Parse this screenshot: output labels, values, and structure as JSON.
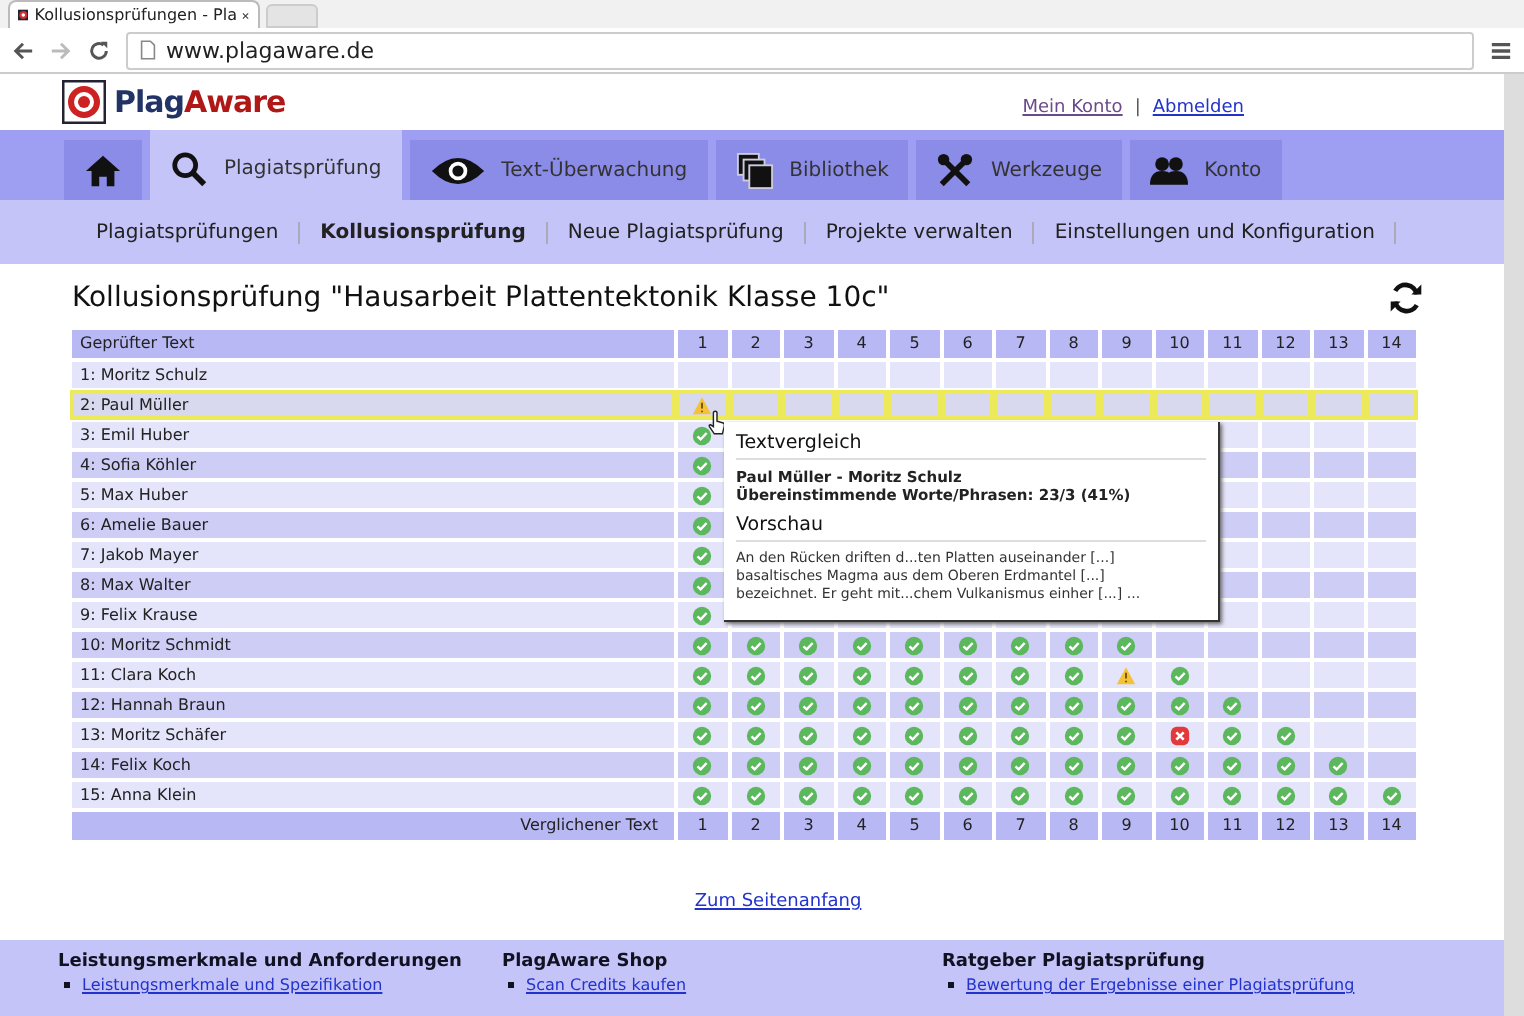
{
  "browser": {
    "tab_title": "Kollusionsprüfungen - Pla",
    "address": "www.plagaware.de"
  },
  "header": {
    "logo_first": "Plag",
    "logo_second": "Aware",
    "links": [
      "Mein Konto",
      "Abmelden"
    ],
    "separator": "|"
  },
  "nav": [
    {
      "kind": "home",
      "selected": false
    },
    {
      "label": "Plagiatsprüfung",
      "kind": "search",
      "selected": true
    },
    {
      "label": "Text-Überwachung",
      "kind": "eye",
      "selected": false
    },
    {
      "label": "Bibliothek",
      "kind": "books",
      "selected": false
    },
    {
      "label": "Werkzeuge",
      "kind": "tools",
      "selected": false
    },
    {
      "label": "Konto",
      "kind": "people",
      "selected": false
    }
  ],
  "subnav": [
    {
      "label": "Plagiatsprüfungen",
      "selected": false
    },
    {
      "label": "Kollusionsprüfung",
      "selected": true
    },
    {
      "label": "Neue Plagiatsprüfung",
      "selected": false
    },
    {
      "label": "Projekte verwalten",
      "selected": false
    },
    {
      "label": "Einstellungen und Konfiguration",
      "selected": false
    }
  ],
  "title": "Kollusionsprüfung \"Hausarbeit Plattentektonik Klasse 10c\"",
  "table": {
    "header": "Geprüfter Text",
    "footer": "Verglichener Text",
    "columns": [
      "1",
      "2",
      "3",
      "4",
      "5",
      "6",
      "7",
      "8",
      "9",
      "10",
      "11",
      "12",
      "13",
      "14"
    ],
    "footer_columns": [
      "1",
      "2",
      "3",
      "4",
      "5",
      "6",
      "7",
      "8",
      "9",
      "10",
      "11",
      "12",
      "13",
      "14"
    ],
    "rows": [
      {
        "name": "1: Moritz Schulz",
        "selected": false,
        "cells": []
      },
      {
        "name": "2: Paul Müller",
        "selected": true,
        "cells": [
          {
            "kind": "warning"
          }
        ]
      },
      {
        "name": "3: Emil Huber",
        "selected": false,
        "cells": [
          {
            "kind": "check"
          }
        ]
      },
      {
        "name": "4: Sofia Köhler",
        "selected": false,
        "cells": [
          {
            "kind": "check"
          }
        ]
      },
      {
        "name": "5: Max Huber",
        "selected": false,
        "cells": [
          {
            "kind": "check"
          }
        ]
      },
      {
        "name": "6: Amelie Bauer",
        "selected": false,
        "cells": [
          {
            "kind": "check"
          }
        ]
      },
      {
        "name": "7: Jakob Mayer",
        "selected": false,
        "cells": [
          {
            "kind": "check"
          }
        ]
      },
      {
        "name": "8: Max Walter",
        "selected": false,
        "cells": [
          {
            "kind": "check"
          }
        ]
      },
      {
        "name": "9: Felix Krause",
        "selected": false,
        "cells": [
          {
            "kind": "check"
          }
        ]
      },
      {
        "name": "10: Moritz Schmidt",
        "selected": false,
        "cells": [
          {
            "kind": "check"
          },
          {
            "kind": "check"
          },
          {
            "kind": "check"
          },
          {
            "kind": "check"
          },
          {
            "kind": "check"
          },
          {
            "kind": "check"
          },
          {
            "kind": "check"
          },
          {
            "kind": "check"
          },
          {
            "kind": "check"
          }
        ]
      },
      {
        "name": "11: Clara Koch",
        "selected": false,
        "cells": [
          {
            "kind": "check"
          },
          {
            "kind": "check"
          },
          {
            "kind": "check"
          },
          {
            "kind": "check"
          },
          {
            "kind": "check"
          },
          {
            "kind": "check"
          },
          {
            "kind": "check"
          },
          {
            "kind": "check"
          },
          {
            "kind": "warning"
          },
          {
            "kind": "check"
          }
        ]
      },
      {
        "name": "12: Hannah Braun",
        "selected": false,
        "cells": [
          {
            "kind": "check"
          },
          {
            "kind": "check"
          },
          {
            "kind": "check"
          },
          {
            "kind": "check"
          },
          {
            "kind": "check"
          },
          {
            "kind": "check"
          },
          {
            "kind": "check"
          },
          {
            "kind": "check"
          },
          {
            "kind": "check"
          },
          {
            "kind": "check"
          },
          {
            "kind": "check"
          }
        ]
      },
      {
        "name": "13: Moritz Schäfer",
        "selected": false,
        "cells": [
          {
            "kind": "check"
          },
          {
            "kind": "check"
          },
          {
            "kind": "check"
          },
          {
            "kind": "check"
          },
          {
            "kind": "check"
          },
          {
            "kind": "check"
          },
          {
            "kind": "check"
          },
          {
            "kind": "check"
          },
          {
            "kind": "check"
          },
          {
            "kind": "error"
          },
          {
            "kind": "check"
          },
          {
            "kind": "check"
          }
        ]
      },
      {
        "name": "14: Felix Koch",
        "selected": false,
        "cells": [
          {
            "kind": "check"
          },
          {
            "kind": "check"
          },
          {
            "kind": "check"
          },
          {
            "kind": "check"
          },
          {
            "kind": "check"
          },
          {
            "kind": "check"
          },
          {
            "kind": "check"
          },
          {
            "kind": "check"
          },
          {
            "kind": "check"
          },
          {
            "kind": "check"
          },
          {
            "kind": "check"
          },
          {
            "kind": "check"
          },
          {
            "kind": "check"
          }
        ]
      },
      {
        "name": "15: Anna Klein",
        "selected": false,
        "cells": [
          {
            "kind": "check"
          },
          {
            "kind": "check"
          },
          {
            "kind": "check"
          },
          {
            "kind": "check"
          },
          {
            "kind": "check"
          },
          {
            "kind": "check"
          },
          {
            "kind": "check"
          },
          {
            "kind": "check"
          },
          {
            "kind": "check"
          },
          {
            "kind": "check"
          },
          {
            "kind": "check"
          },
          {
            "kind": "check"
          },
          {
            "kind": "check"
          },
          {
            "kind": "check"
          }
        ]
      }
    ]
  },
  "tooltip": {
    "heading": "Textvergleich",
    "pair": "Paul Müller - Moritz Schulz",
    "match": "Übereinstimmende Worte/Phrasen: 23/3 (41%)",
    "preview_heading": "Vorschau",
    "preview": [
      "An den Rücken driften d...ten Platten auseinander [...]",
      "basaltisches Magma aus dem Oberen Erdmantel [...]",
      "bezeichnet. Er geht mit...chem Vulkanismus einher [...] ..."
    ]
  },
  "top_link": "Zum Seitenanfang",
  "footer": [
    {
      "heading": "Leistungsmerkmale und Anforderungen",
      "items": [
        "Leistungsmerkmale und Spezifikation"
      ]
    },
    {
      "heading": "PlagAware Shop",
      "items": [
        "Scan Credits kaufen"
      ]
    },
    {
      "heading": "Ratgeber Plagiatsprüfung",
      "items": [
        "Bewertung der Ergebnisse einer Plagiatsprüfung"
      ]
    }
  ]
}
